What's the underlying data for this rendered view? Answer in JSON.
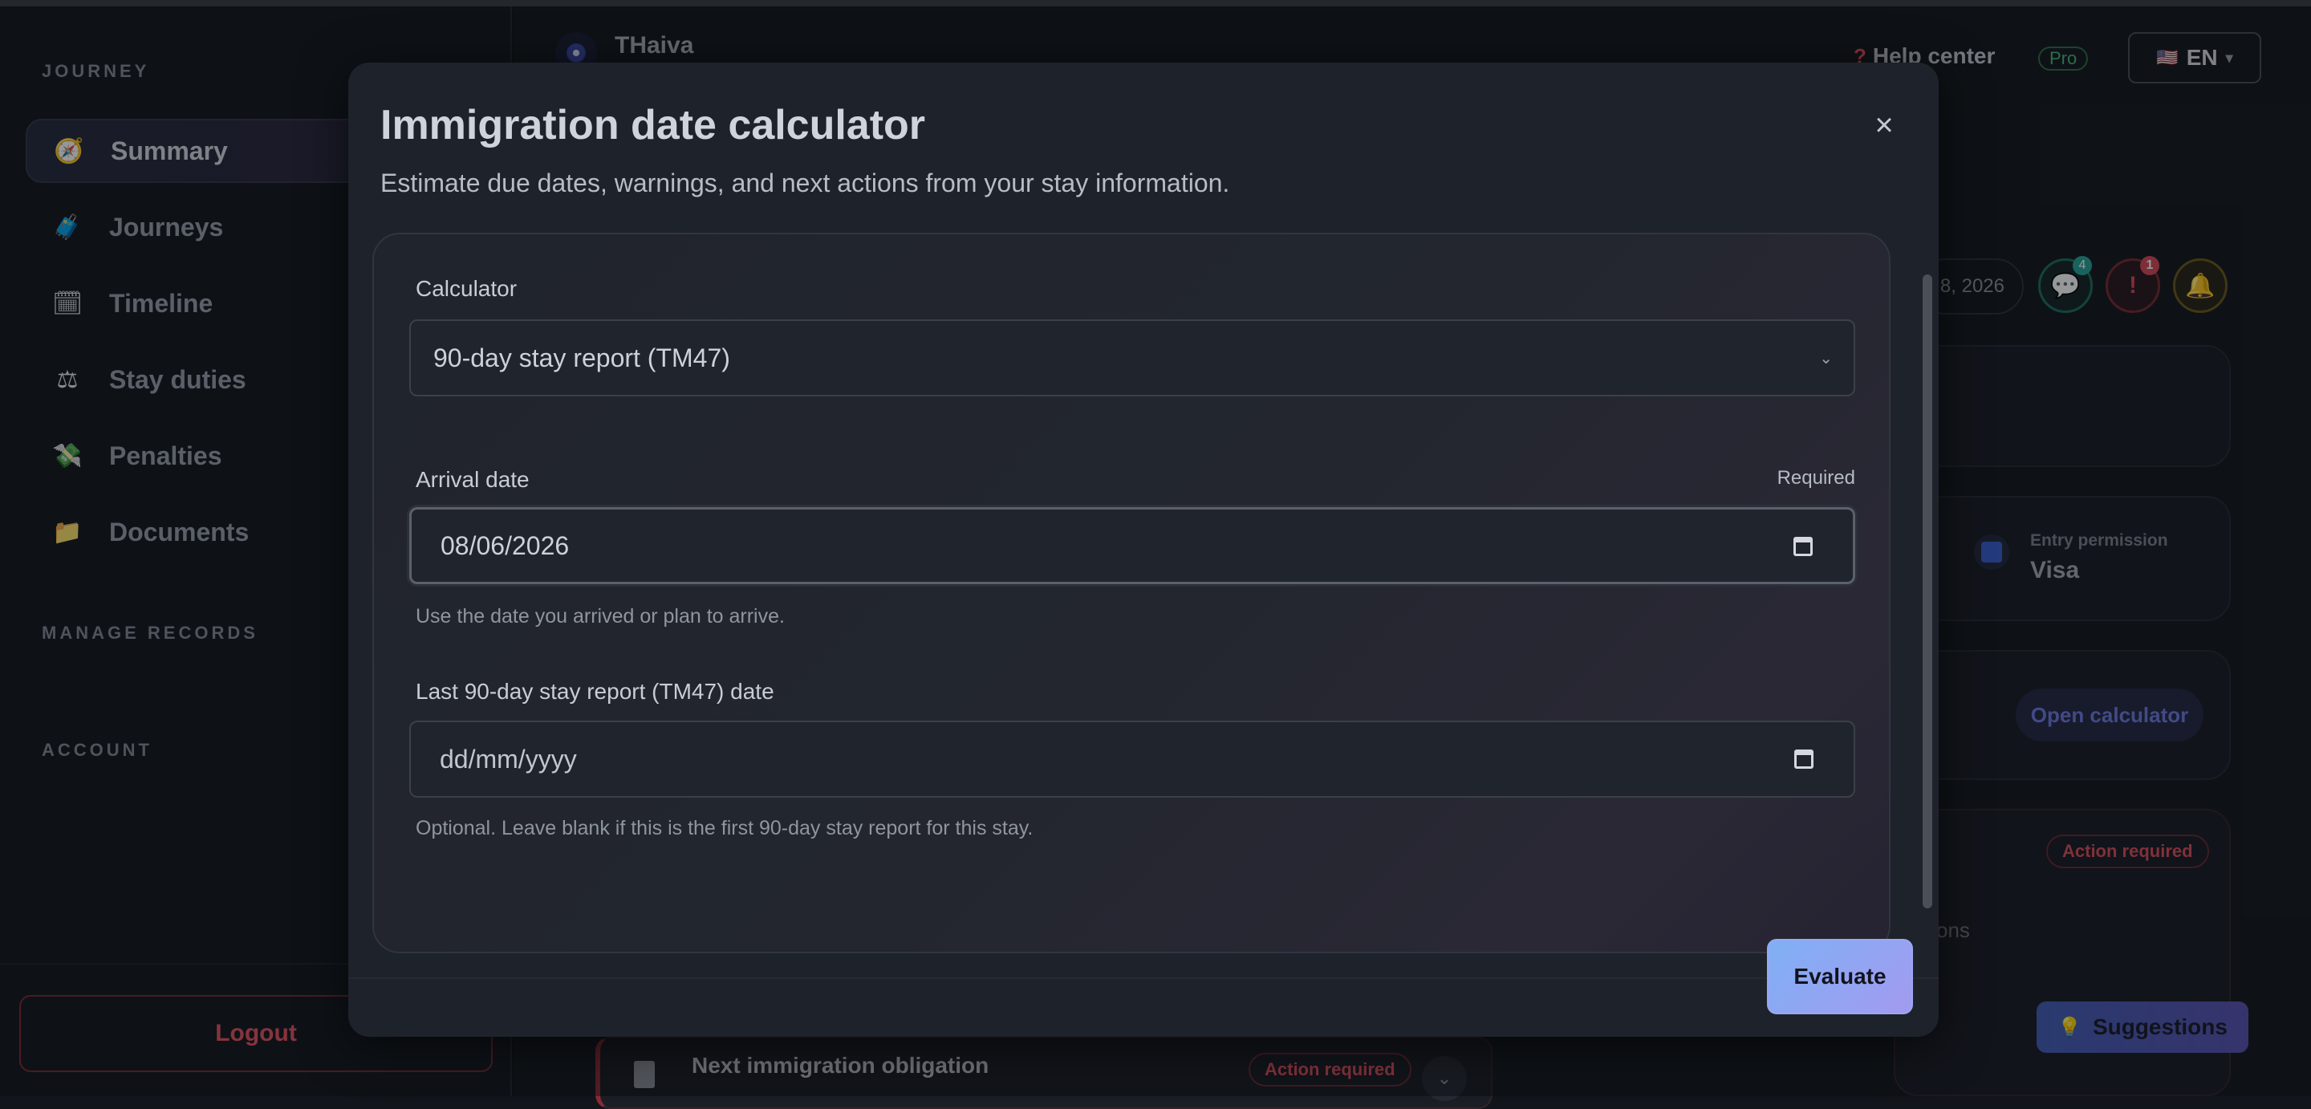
{
  "sidebar": {
    "section_journey": "JOURNEY",
    "items": [
      {
        "label": "Summary",
        "icon": "compass-icon",
        "glyph": "🧭",
        "active": true
      },
      {
        "label": "Journeys",
        "icon": "luggage-icon",
        "glyph": "🧳"
      },
      {
        "label": "Timeline",
        "icon": "calendar-icon",
        "glyph": "🗓"
      },
      {
        "label": "Stay duties",
        "icon": "scales-icon",
        "glyph": "⚖"
      },
      {
        "label": "Penalties",
        "icon": "money-icon",
        "glyph": "💸"
      },
      {
        "label": "Documents",
        "icon": "folder-icon",
        "glyph": "📁"
      }
    ],
    "section_manage": "MANAGE RECORDS",
    "section_account": "ACCOUNT",
    "logout_label": "Logout"
  },
  "header": {
    "brand": "THaiva",
    "help_label": "Help center",
    "help_glyph": "?",
    "pro_label": "Pro",
    "lang_flag": "🇺🇸",
    "lang_label": "EN"
  },
  "background": {
    "date_pill": "8, 2026",
    "chat_count": "4",
    "alert_count": "1",
    "chat_glyph": "💬",
    "alert_glyph": "!",
    "bell_glyph": "🔔",
    "entry_label": "Entry permission",
    "entry_value": "Visa",
    "open_calculator": "Open calculator",
    "action_required": "Action required",
    "partial_text": "tions",
    "next_obligation": "Next immigration obligation",
    "suggestions": "Suggestions",
    "bulb_glyph": "💡"
  },
  "modal": {
    "title": "Immigration date calculator",
    "subtitle": "Estimate due dates, warnings, and next actions from your stay information.",
    "close_glyph": "×",
    "calculator_label": "Calculator",
    "calculator_value": "90-day stay report (TM47)",
    "arrival_label": "Arrival date",
    "required_label": "Required",
    "arrival_value": "08/06/2026",
    "arrival_hint": "Use the date you arrived or plan to arrive.",
    "last_report_label": "Last 90-day stay report (TM47) date",
    "last_report_placeholder": "dd/mm/yyyy",
    "last_report_hint": "Optional. Leave blank if this is the first 90-day stay report for this stay.",
    "evaluate_label": "Evaluate"
  },
  "colors": {
    "accent": "#7f9cf5",
    "danger": "#e25563",
    "success": "#45b87a"
  }
}
